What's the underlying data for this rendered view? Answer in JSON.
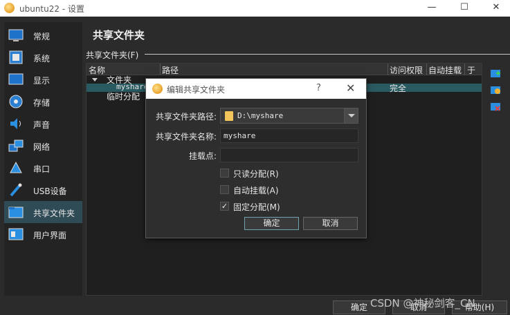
{
  "window": {
    "title": "ubuntu22 - 设置",
    "min_glyph": "—",
    "max_glyph": "☐",
    "close_glyph": "✕"
  },
  "sidebar": {
    "items": [
      {
        "label": "常规",
        "icon": "general-icon"
      },
      {
        "label": "系统",
        "icon": "system-icon"
      },
      {
        "label": "显示",
        "icon": "display-icon"
      },
      {
        "label": "存储",
        "icon": "storage-icon"
      },
      {
        "label": "声音",
        "icon": "audio-icon"
      },
      {
        "label": "网络",
        "icon": "network-icon"
      },
      {
        "label": "串口",
        "icon": "serial-port-icon"
      },
      {
        "label": "USB设备",
        "icon": "usb-icon"
      },
      {
        "label": "共享文件夹",
        "icon": "shared-folder-icon",
        "active": true
      },
      {
        "label": "用户界面",
        "icon": "user-interface-icon"
      }
    ]
  },
  "main": {
    "page_title": "共享文件夹",
    "section_label": "共享文件夹(F)",
    "table": {
      "columns": [
        "名称",
        "路径",
        "访问权限",
        "自动挂载",
        "于"
      ],
      "group_machine": "文件夹",
      "row_name": "myshare",
      "row_access": "完全",
      "group_transient": "临时分配"
    },
    "tools": [
      "add-share-icon",
      "edit-share-icon",
      "remove-share-icon"
    ]
  },
  "footer": {
    "ok": "确定",
    "cancel": "取消",
    "help": "帮助(H)"
  },
  "watermark": "CSDN @神秘剑客_CN",
  "dialog": {
    "title": "编辑共享文件夹",
    "help_glyph": "?",
    "close_glyph": "✕",
    "path_label": "共享文件夹路径:",
    "path_value": "D:\\myshare",
    "name_label": "共享文件夹名称:",
    "name_value": "myshare",
    "mount_label": "挂载点:",
    "mount_value": "",
    "readonly_label": "只读分配(R)",
    "readonly_checked": false,
    "automount_label": "自动挂载(A)",
    "automount_checked": false,
    "permanent_label": "固定分配(M)",
    "permanent_checked": true,
    "check_mark": "✓",
    "ok": "确定",
    "cancel": "取消"
  }
}
